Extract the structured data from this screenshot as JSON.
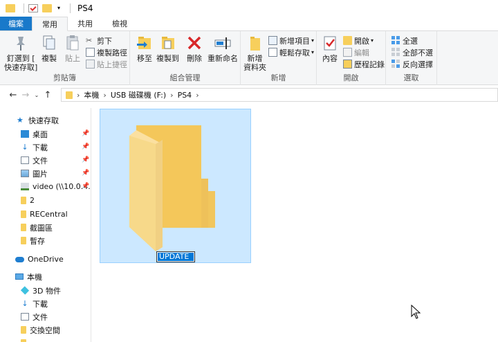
{
  "window": {
    "title": "PS4"
  },
  "tabs": [
    {
      "label": "檔案"
    },
    {
      "label": "常用"
    },
    {
      "label": "共用"
    },
    {
      "label": "檢視"
    }
  ],
  "ribbon": {
    "clipboard": {
      "label": "剪貼簿",
      "pin_line1": "釘選到 [",
      "pin_line2": "快速存取]",
      "copy": "複製",
      "paste": "貼上",
      "cut": "剪下",
      "copy_path": "複製路徑",
      "paste_shortcut": "貼上捷徑"
    },
    "organize": {
      "label": "組合管理",
      "move_to": "移至",
      "copy_to": "複製到",
      "delete": "刪除",
      "rename": "重新命名"
    },
    "new": {
      "label": "新增",
      "new_folder_line1": "新增",
      "new_folder_line2": "資料夾",
      "new_item": "新增項目",
      "easy_access": "輕鬆存取"
    },
    "open": {
      "label": "開啟",
      "properties": "內容",
      "open": "開啟",
      "edit": "編輯",
      "history": "歷程記錄"
    },
    "select": {
      "label": "選取",
      "select_all": "全選",
      "select_none": "全部不選",
      "invert": "反向選擇"
    }
  },
  "address": {
    "crumbs": [
      "本機",
      "USB 磁碟機 (F:)",
      "PS4"
    ]
  },
  "nav": {
    "quick_access": "快速存取",
    "items": [
      {
        "label": "桌面"
      },
      {
        "label": "下載"
      },
      {
        "label": "文件"
      },
      {
        "label": "圖片"
      },
      {
        "label": "video (\\\\10.0.4."
      },
      {
        "label": "2"
      },
      {
        "label": "RECentral"
      },
      {
        "label": "截圖區"
      },
      {
        "label": "暫存"
      }
    ],
    "onedrive": "OneDrive",
    "this_pc": "本機",
    "pc_items": [
      {
        "label": "3D 物件"
      },
      {
        "label": "下載"
      },
      {
        "label": "文件"
      },
      {
        "label": "交換空間"
      }
    ]
  },
  "content": {
    "folder_name": "UPDATE"
  },
  "colors": {
    "accent": "#1979ca",
    "selection": "#cce8ff",
    "folder": "#f7cf5c"
  }
}
